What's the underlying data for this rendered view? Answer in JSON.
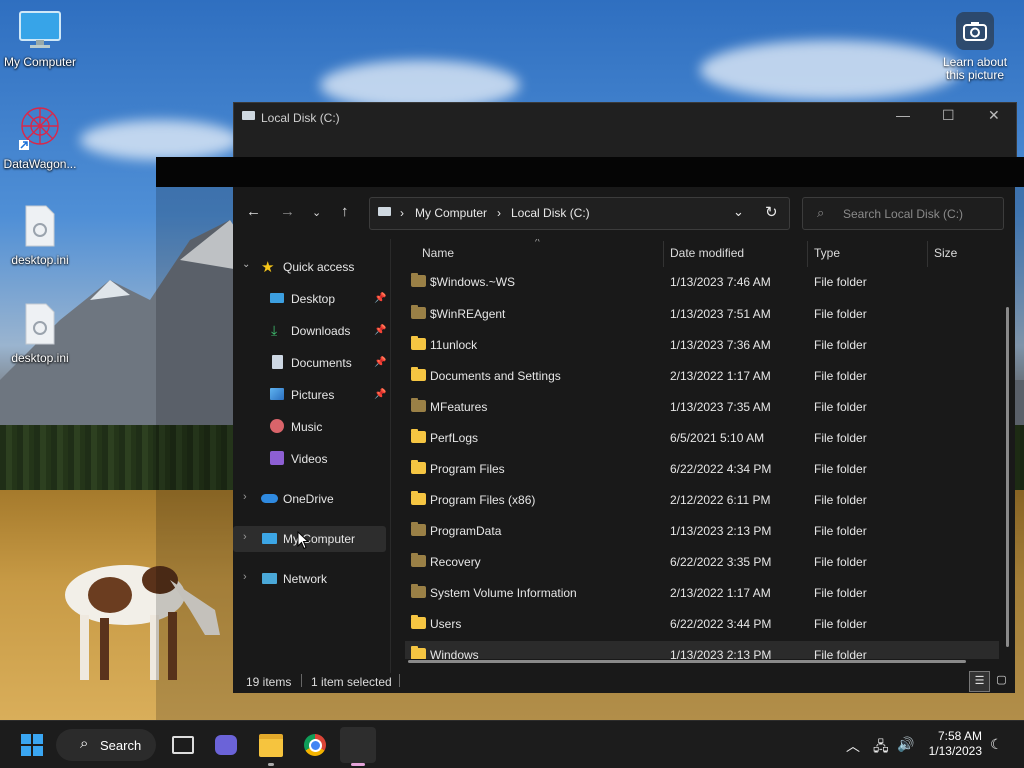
{
  "desktop": {
    "icons": [
      {
        "label": "My Computer"
      },
      {
        "label": "DataWagon..."
      },
      {
        "label": "desktop.ini"
      },
      {
        "label": "desktop.ini"
      }
    ],
    "learn_label": "Learn about this picture"
  },
  "back_window": {
    "title": "Local Disk (C:)"
  },
  "explorer": {
    "breadcrumb": [
      "My Computer",
      "Local Disk (C:)"
    ],
    "search_placeholder": "Search Local Disk (C:)",
    "sidebar": {
      "quick_access": "Quick access",
      "items": [
        "Desktop",
        "Downloads",
        "Documents",
        "Pictures",
        "Music",
        "Videos"
      ],
      "onedrive": "OneDrive",
      "my_computer": "My Computer",
      "network": "Network"
    },
    "columns": [
      "Name",
      "Date modified",
      "Type",
      "Size"
    ],
    "rows": [
      {
        "name": "$Windows.~WS",
        "date": "1/13/2023 7:46 AM",
        "type": "File folder"
      },
      {
        "name": "$WinREAgent",
        "date": "1/13/2023 7:51 AM",
        "type": "File folder"
      },
      {
        "name": "11unlock",
        "date": "1/13/2023 7:36 AM",
        "type": "File folder"
      },
      {
        "name": "Documents and Settings",
        "date": "2/13/2022 1:17 AM",
        "type": "File folder"
      },
      {
        "name": "MFeatures",
        "date": "1/13/2023 7:35 AM",
        "type": "File folder"
      },
      {
        "name": "PerfLogs",
        "date": "6/5/2021 5:10 AM",
        "type": "File folder"
      },
      {
        "name": "Program Files",
        "date": "6/22/2022 4:34 PM",
        "type": "File folder"
      },
      {
        "name": "Program Files (x86)",
        "date": "2/12/2022 6:11 PM",
        "type": "File folder"
      },
      {
        "name": "ProgramData",
        "date": "1/13/2023 2:13 PM",
        "type": "File folder"
      },
      {
        "name": "Recovery",
        "date": "6/22/2022 3:35 PM",
        "type": "File folder"
      },
      {
        "name": "System Volume Information",
        "date": "2/13/2022 1:17 AM",
        "type": "File folder"
      },
      {
        "name": "Users",
        "date": "6/22/2022 3:44 PM",
        "type": "File folder"
      },
      {
        "name": "Windows",
        "date": "1/13/2023 2:13 PM",
        "type": "File folder"
      }
    ],
    "status_count": "19 items",
    "status_selected": "1 item selected"
  },
  "taskbar": {
    "search_label": "Search",
    "time": "7:58 AM",
    "date": "1/13/2023"
  }
}
